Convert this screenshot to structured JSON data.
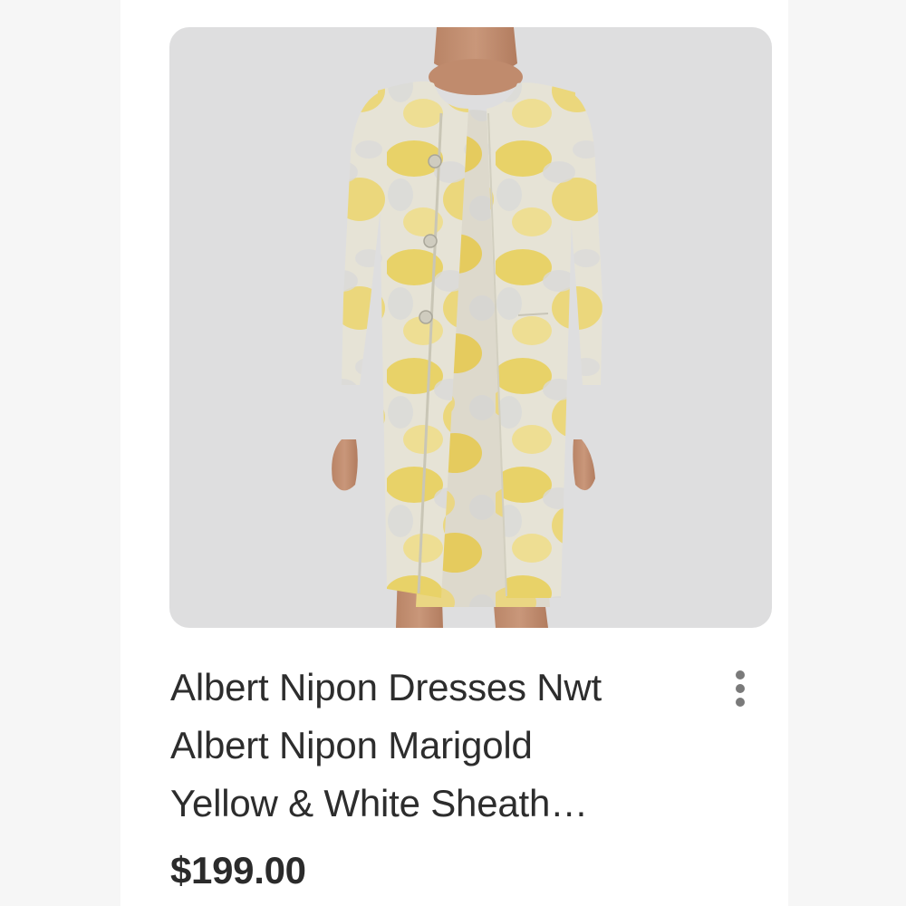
{
  "product": {
    "image_alt": "Albert Nipon Marigold Yellow & White Sheath dress with matching coat",
    "title_lines": [
      "Albert Nipon Dresses Nwt",
      "Albert Nipon Marigold",
      "Yellow & White Sheath…"
    ],
    "price": "$199.00"
  },
  "icons": {
    "more": "more-vertical-icon"
  },
  "colors": {
    "photo_background": "#dededf",
    "fabric_yellow": "#e8cf52",
    "fabric_white": "#e4e4e2",
    "text": "#2d2d2d"
  }
}
